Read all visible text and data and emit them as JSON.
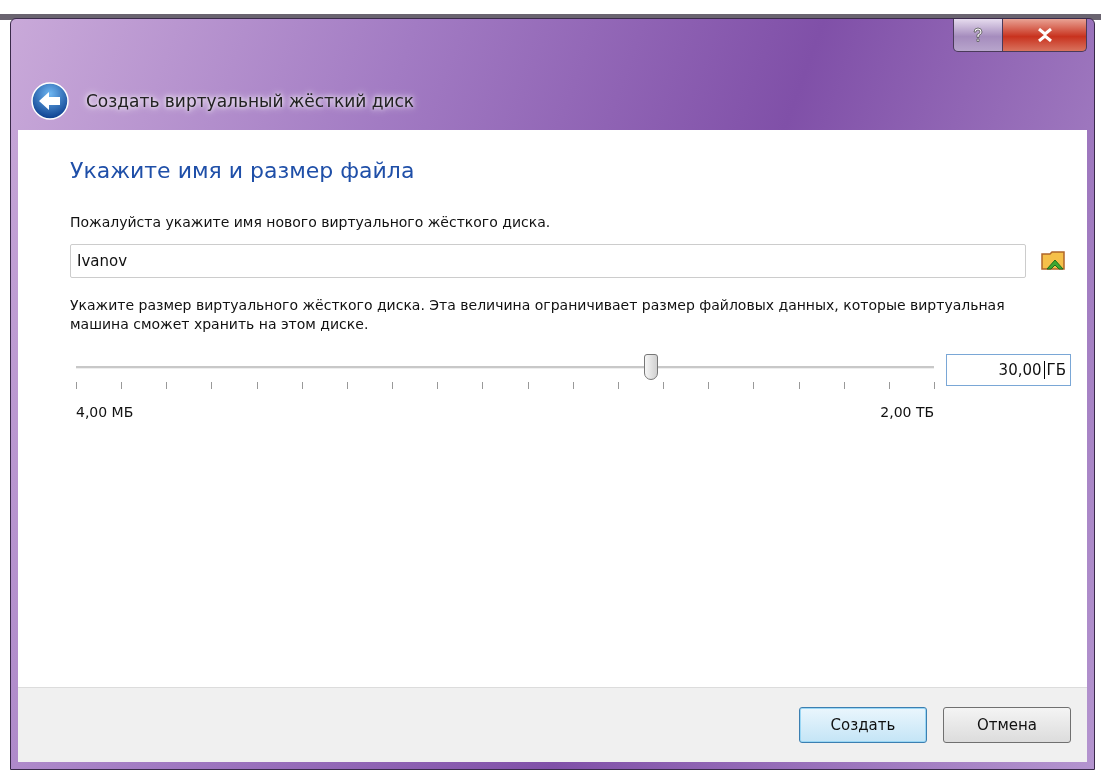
{
  "window": {
    "title": "Создать виртуальный жёсткий диск"
  },
  "heading": "Укажите имя и размер файла",
  "name_prompt": "Пожалуйста укажите имя нового виртуального жёсткого диска.",
  "name_field": {
    "value": "Ivanov"
  },
  "size_prompt": "Укажите размер виртуального жёсткого диска. Эта величина ограничивает размер файловых данных, которые виртуальная машина сможет хранить на этом диске.",
  "size_slider": {
    "level": 0.67,
    "min_label": "4,00 МБ",
    "max_label": "2,00 ТБ"
  },
  "size_field": {
    "value": "30,00",
    "unit": "ГБ"
  },
  "buttons": [
    {
      "label": "Создать",
      "default": true
    },
    {
      "label": "Отмена",
      "default": false
    }
  ]
}
